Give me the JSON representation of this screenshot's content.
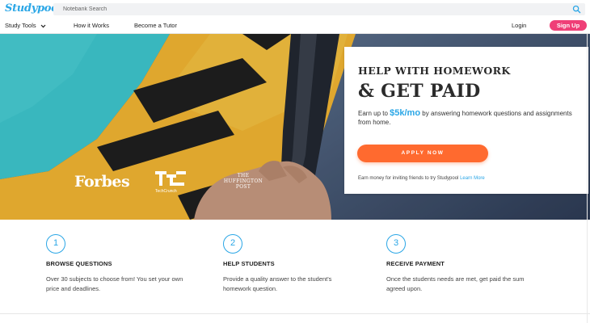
{
  "brand": {
    "logo_text": "Studypool",
    "accent": "#2aa6e6",
    "signup_color": "#ef3f77",
    "cta_color": "#ff6a2f"
  },
  "search": {
    "placeholder": "Notebank Search",
    "icon": "search-icon"
  },
  "nav": {
    "study_tools": "Study Tools",
    "how_it_works": "How it Works",
    "become_tutor": "Become a Tutor",
    "login": "Login",
    "signup": "Sign Up"
  },
  "hero": {
    "press": {
      "forbes": "Forbes",
      "techcrunch_mark": "TC",
      "techcrunch": "TechCrunch",
      "huffington": "THE HUFFINGTON POST"
    }
  },
  "card": {
    "title_line1": "HELP WITH HOMEWORK",
    "title_line2": "& GET PAID",
    "body_prefix": "Earn up to ",
    "amount": "$5k/mo",
    "body_suffix": " by answering homework questions and assignments from home.",
    "apply_label": "APPLY NOW",
    "footer_text": "Earn money for inviting friends to try Studypool ",
    "footer_link": "Learn More"
  },
  "steps": [
    {
      "number": "1",
      "title": "BROWSE QUESTIONS",
      "desc": "Over 30 subjects to choose from! You set your own price and deadlines."
    },
    {
      "number": "2",
      "title": "HELP STUDENTS",
      "desc": "Provide a quality answer to the student's homework question."
    },
    {
      "number": "3",
      "title": "RECEIVE PAYMENT",
      "desc": "Once the students needs are met, get paid the sum agreed upon."
    }
  ]
}
